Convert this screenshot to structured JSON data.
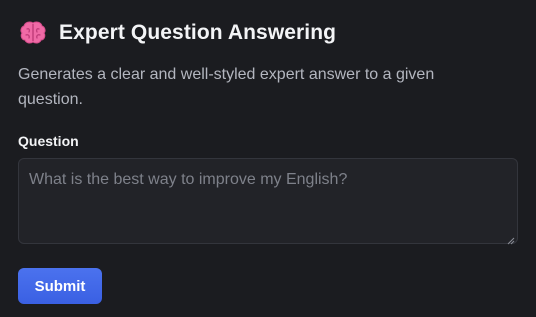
{
  "header": {
    "icon": "brain-icon",
    "title": "Expert Question Answering"
  },
  "description": "Generates a clear and well-styled expert answer to a given question.",
  "form": {
    "question_label": "Question",
    "question_value": "",
    "question_placeholder": "What is the best way to improve my English?",
    "submit_label": "Submit"
  },
  "colors": {
    "background": "#1b1c20",
    "accent": "#4169e8",
    "brain": "#f06aa6"
  }
}
